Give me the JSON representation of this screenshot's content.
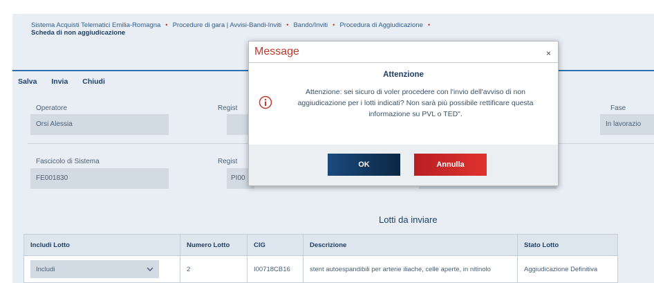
{
  "breadcrumb": {
    "items": [
      "Sistema Acquisti Telematici Emilia-Romagna",
      "Procedure di gara | Avvisi-Bandi-Inviti",
      "Bando/Inviti",
      "Procedura di Aggiudicazione"
    ],
    "subtitle": "Scheda di non aggiudicazione"
  },
  "toolbar": {
    "save": "Salva",
    "send": "Invia",
    "close": "Chiudi"
  },
  "form": {
    "operatore_label": "Operatore",
    "operatore_value": "Orsi Alessia",
    "registro1_label": "Regist",
    "fase_label": "Fase",
    "fase_value": "In lavorazio",
    "fascicolo_label": "Fascicolo di Sistema",
    "fascicolo_value": "FE001830",
    "registro2_label": "Regist",
    "registro2_value": "PI00"
  },
  "table": {
    "title": "Lotti da inviare",
    "headers": [
      "Includi Lotto",
      "Numero Lotto",
      "CIG",
      "Descrizione",
      "Stato Lotto"
    ],
    "row": {
      "include": "Includi",
      "numero": "2",
      "cig": "I00718CB16",
      "descrizione": "stent autoespandibili per arterie iliache, celle aperte, in nitinolo",
      "stato": "Aggiudicazione Definitiva"
    }
  },
  "modal": {
    "title": "Message",
    "close_glyph": "×",
    "heading": "Attenzione",
    "message": "Attenzione: sei sicuro di voler procedere con l'invio dell'avviso di non aggiudicazione per i lotti indicati? Non sarà più possibile rettificare questa informazione su PVL o TED\".",
    "ok_label": "OK",
    "cancel_label": "Annulla"
  },
  "colors": {
    "accent_blue": "#1a4a7d",
    "accent_red": "#c0392b"
  }
}
